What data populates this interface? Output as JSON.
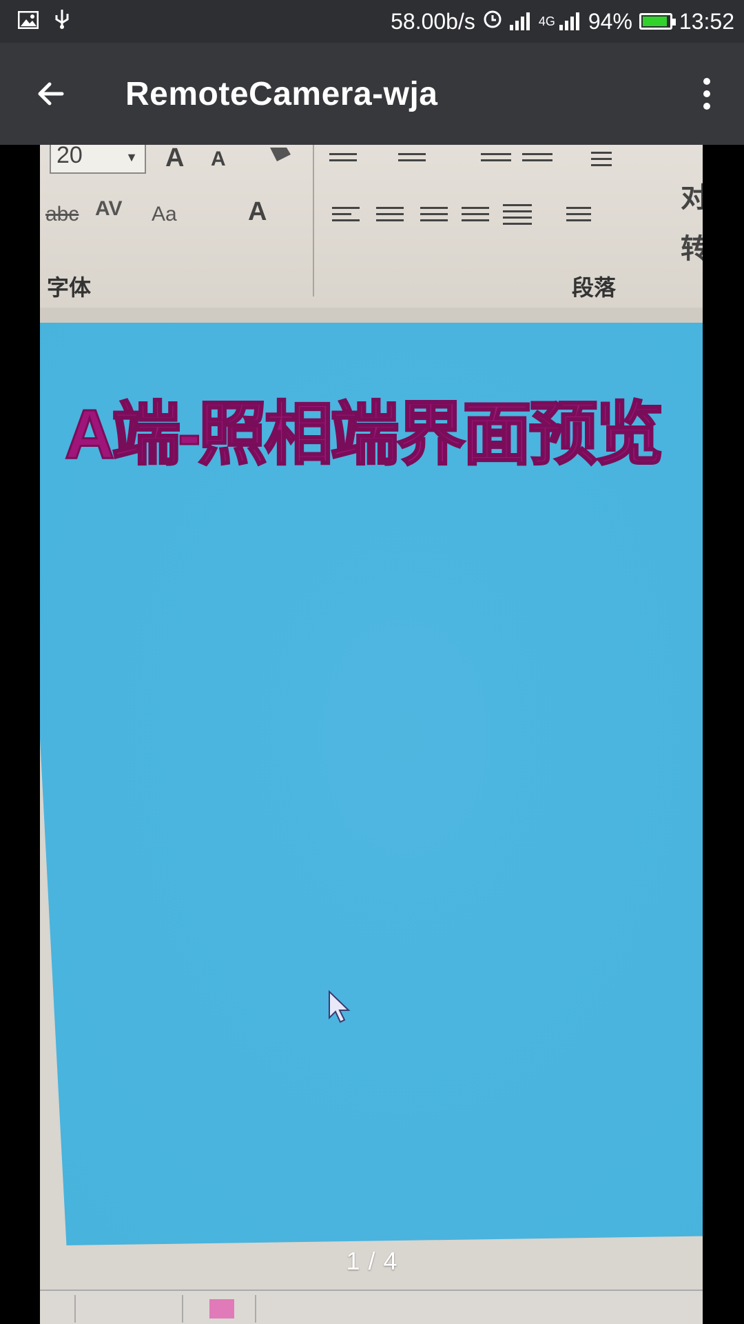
{
  "status_bar": {
    "network_speed": "58.00b/s",
    "network_type": "4G",
    "battery_percent": "94%",
    "battery_level": 0.94,
    "battery_color": "#31d22c",
    "time": "13:52",
    "icons": [
      "image-icon",
      "usb-icon",
      "alarm-icon",
      "signal-icon",
      "signal-4g-icon",
      "battery-icon"
    ]
  },
  "app_bar": {
    "title": "RemoteCamera-wja",
    "background": "#37383c"
  },
  "photo": {
    "ribbon": {
      "font_size": "20",
      "font_group_label": "字体",
      "paragraph_group_label": "段落",
      "text_controls": [
        "A",
        "A",
        "abc",
        "AV",
        "Aa",
        "A"
      ],
      "right_fragments": [
        "对",
        "转"
      ]
    },
    "slide": {
      "title": "A端-照相端界面预览",
      "title_color": "#a0157a",
      "background": "#4bb5df"
    }
  },
  "pager": {
    "label": "1 / 4"
  }
}
